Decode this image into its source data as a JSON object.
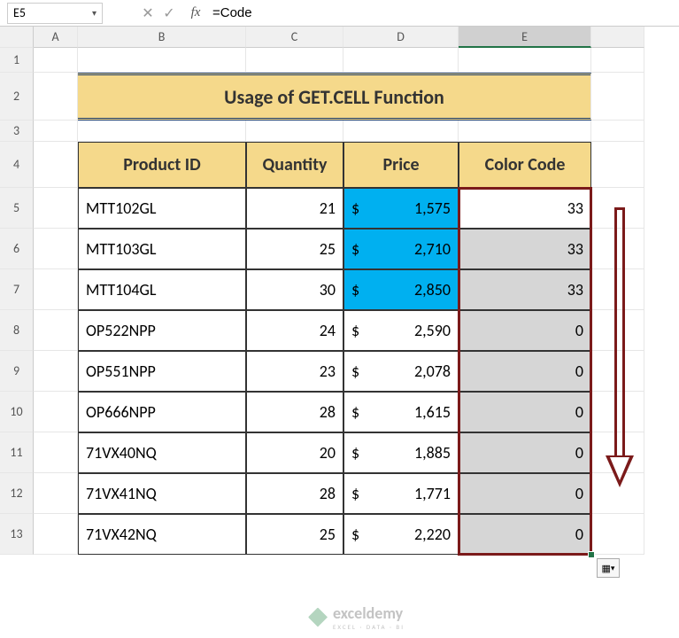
{
  "namebox": {
    "value": "E5"
  },
  "formula": {
    "value": "=Code"
  },
  "columns": [
    "A",
    "B",
    "C",
    "D",
    "E"
  ],
  "active_col": "E",
  "rows": [
    "1",
    "2",
    "3",
    "4",
    "5",
    "6",
    "7",
    "8",
    "9",
    "10",
    "11",
    "12",
    "13"
  ],
  "title": "Usage of GET.CELL Function",
  "headers": {
    "b": "Product ID",
    "c": "Quantity",
    "d": "Price",
    "e": "Color Code"
  },
  "table": [
    {
      "prod": "MTT102GL",
      "qty": "21",
      "price": "1,575",
      "code": "33",
      "hilite": true
    },
    {
      "prod": "MTT103GL",
      "qty": "25",
      "price": "2,710",
      "code": "33",
      "hilite": true
    },
    {
      "prod": "MTT104GL",
      "qty": "30",
      "price": "2,850",
      "code": "33",
      "hilite": true
    },
    {
      "prod": "OP522NPP",
      "qty": "24",
      "price": "2,590",
      "code": "0",
      "hilite": false
    },
    {
      "prod": "OP551NPP",
      "qty": "23",
      "price": "2,078",
      "code": "0",
      "hilite": false
    },
    {
      "prod": "OP666NPP",
      "qty": "28",
      "price": "1,615",
      "code": "0",
      "hilite": false
    },
    {
      "prod": "71VX40NQ",
      "qty": "20",
      "price": "1,885",
      "code": "0",
      "hilite": false
    },
    {
      "prod": "71VX41NQ",
      "qty": "28",
      "price": "1,771",
      "code": "0",
      "hilite": false
    },
    {
      "prod": "71VX42NQ",
      "qty": "25",
      "price": "2,220",
      "code": "0",
      "hilite": false
    }
  ],
  "currency": "$",
  "watermark": {
    "name": "exceldemy",
    "tag": "EXCEL · DATA · BI"
  }
}
